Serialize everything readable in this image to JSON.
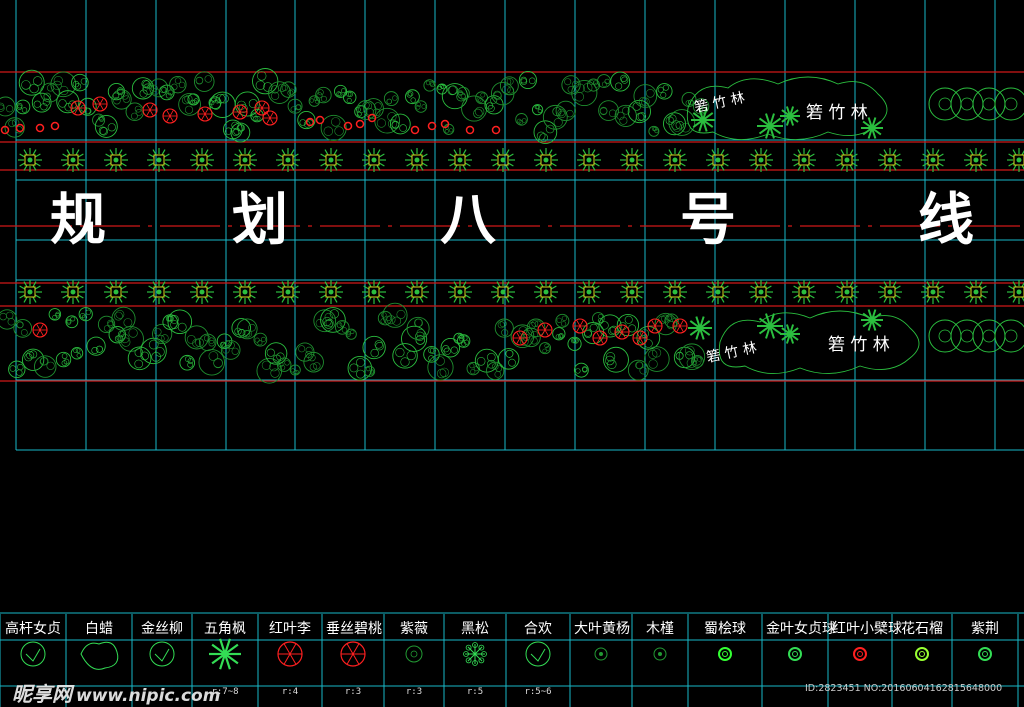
{
  "road": {
    "title_chars": [
      "规",
      "划",
      "八",
      "号",
      "线"
    ],
    "bamboo_label": "箬竹林",
    "bamboo_label_small": "箬 竹 林",
    "bamboo_label_large": "箬 竹 林"
  },
  "legend": {
    "items": [
      {
        "name": "高杆女贞",
        "symbol": "round-tree",
        "color": "#33dd55",
        "spec": ""
      },
      {
        "name": "白蜡",
        "symbol": "loose-tree",
        "color": "#33dd55",
        "spec": ""
      },
      {
        "name": "金丝柳",
        "symbol": "round-tree",
        "color": "#33dd55",
        "spec": ""
      },
      {
        "name": "五角枫",
        "symbol": "star-leaf",
        "color": "#33dd55",
        "spec": "r:7~8"
      },
      {
        "name": "红叶李",
        "symbol": "spoke-tree",
        "color": "#ff2020",
        "spec": "r:4"
      },
      {
        "name": "垂丝碧桃",
        "symbol": "spoke-tree",
        "color": "#ff2020",
        "spec": "r:3"
      },
      {
        "name": "紫薇",
        "symbol": "shrub",
        "color": "#229933",
        "spec": "r:3"
      },
      {
        "name": "黑松",
        "symbol": "pine",
        "color": "#33dd55",
        "spec": "r:5"
      },
      {
        "name": "合欢",
        "symbol": "round-tree",
        "color": "#33dd55",
        "spec": "r:5~6"
      },
      {
        "name": "大叶黄杨",
        "symbol": "small-shrub",
        "color": "#229933",
        "spec": ""
      },
      {
        "name": "木槿",
        "symbol": "small-shrub",
        "color": "#229933",
        "spec": ""
      },
      {
        "name": "蜀桧球",
        "symbol": "ball",
        "color": "#33ff33",
        "spec": ""
      },
      {
        "name": "金叶女贞球",
        "symbol": "ball",
        "color": "#33dd55",
        "spec": ""
      },
      {
        "name": "红叶小檗球",
        "symbol": "ball",
        "color": "#ff2020",
        "spec": ""
      },
      {
        "name": "花石榴",
        "symbol": "ball",
        "color": "#99ff33",
        "spec": ""
      },
      {
        "name": "紫荆",
        "symbol": "ball",
        "color": "#33dd55",
        "spec": ""
      }
    ]
  },
  "watermark": {
    "brand": "昵享网",
    "site": "www.nipic.com",
    "stamp": "ID:2823451 NO:20160604162815648000"
  },
  "colors": {
    "background": "#000000",
    "grid": "#18b8c8",
    "boundary": "#d01818",
    "plant_green": "#33dd55",
    "plant_red": "#ff2020",
    "text": "#ffffff"
  }
}
